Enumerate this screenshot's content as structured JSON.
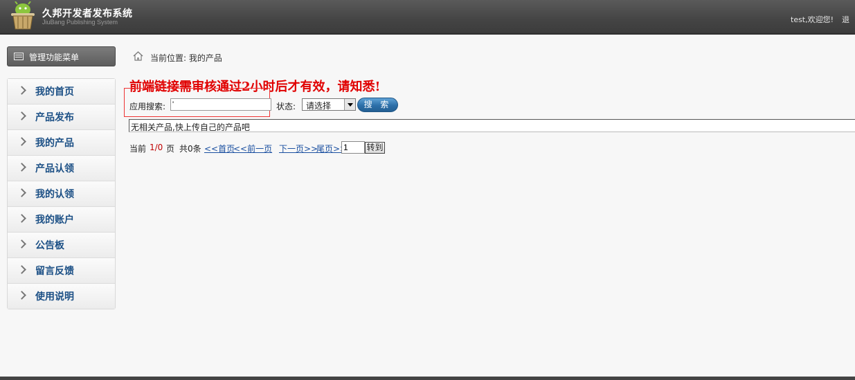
{
  "header": {
    "title": "久邦开发者发布系统",
    "subtitle": "JiuBang Publishing System",
    "welcome": "test,欢迎您!",
    "extra": "退"
  },
  "sidebar": {
    "menu_title": "管理功能菜单",
    "items": [
      {
        "label": "我的首页"
      },
      {
        "label": "产品发布"
      },
      {
        "label": "我的产品"
      },
      {
        "label": "产品认领"
      },
      {
        "label": "我的认领"
      },
      {
        "label": "我的账户"
      },
      {
        "label": "公告板"
      },
      {
        "label": "留言反馈"
      },
      {
        "label": "使用说明"
      }
    ]
  },
  "breadcrumb": {
    "text": "当前位置: 我的产品"
  },
  "notice": "前端链接需审核通过2小时后才有效，请知悉!",
  "search": {
    "label": "应用搜索:",
    "value": "'",
    "status_label": "状态:",
    "status_selected": "请选择",
    "button": "搜 索"
  },
  "results": {
    "empty_text": "无相关产品,快上传自己的产品吧"
  },
  "pager": {
    "prefix": "当前",
    "page_status": "1/0",
    "page_unit": "页",
    "total": "共0条",
    "first": "<<首页",
    "prev": "<<前一页",
    "next": "下一页>>",
    "last": "尾页>>",
    "page_input": "1",
    "go": "转到"
  },
  "colors": {
    "header_bg": "#444444",
    "menu_link": "#1b4f85",
    "notice": "#e00000",
    "button_blue": "#2c6fa8"
  }
}
